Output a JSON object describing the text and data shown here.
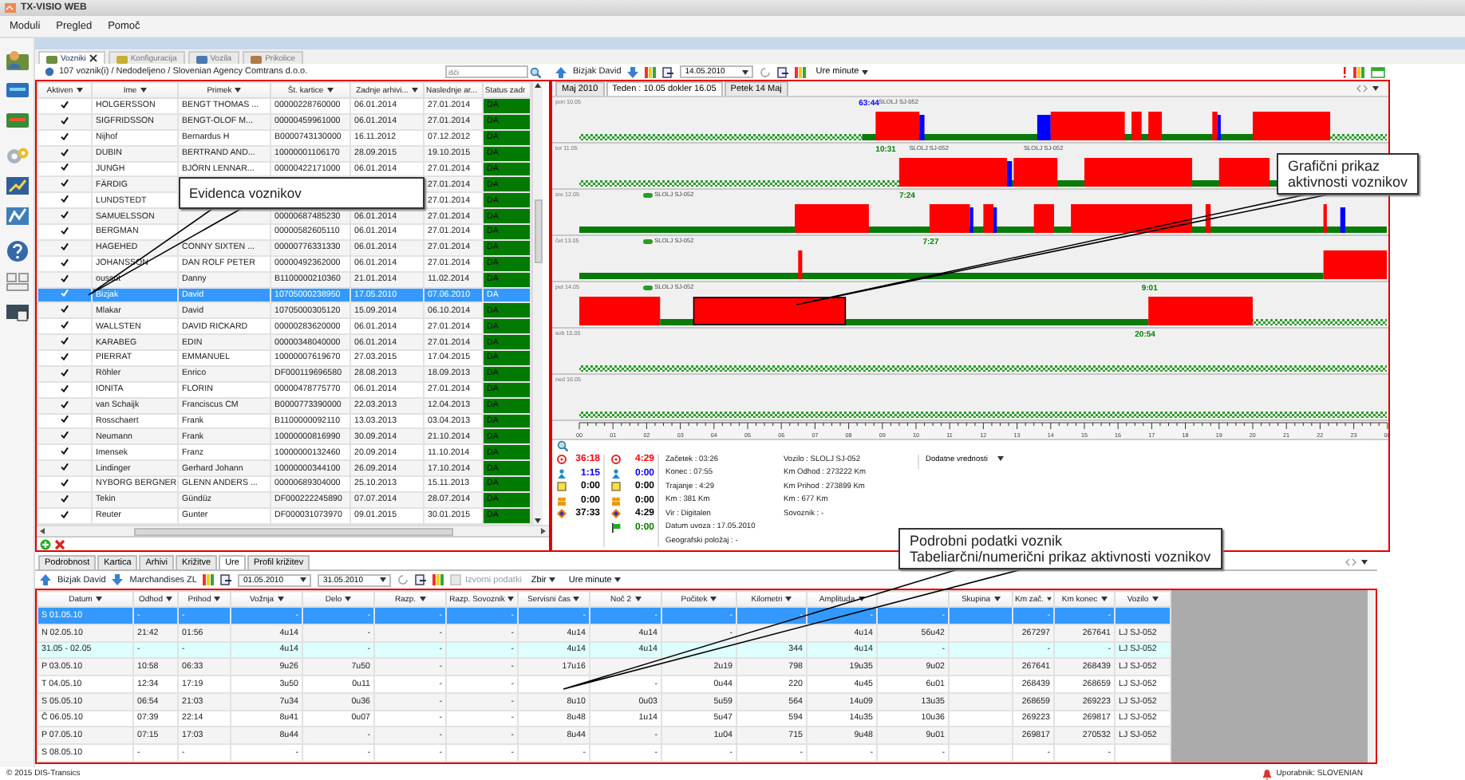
{
  "window": {
    "title": "TX-VISIO WEB"
  },
  "menu": [
    "Moduli",
    "Pregled",
    "Pomoč"
  ],
  "module_tabs": [
    {
      "label": "Vozniki",
      "selected": true,
      "closable": true
    },
    {
      "label": "Konfiguracija",
      "selected": false,
      "closable": false
    },
    {
      "label": "Vozila",
      "selected": false,
      "closable": false
    },
    {
      "label": "Prikolice",
      "selected": false,
      "closable": false
    }
  ],
  "breadcrumb": "107 voznik(i) / Nedodeljeno / Slovenian Agency Comtrans d.o.o.",
  "search": {
    "placeholder": "išči"
  },
  "drivers": {
    "active_column": "Aktiven",
    "columns": [
      "Ime",
      "Primek",
      "Št. kartice",
      "Zadnje arhivi...",
      "Naslednje ar..."
    ],
    "status_column": "Status zadr",
    "rows": [
      {
        "active": true,
        "selected": false,
        "cells": [
          "HOLGERSSON",
          "BENGT THOMAS ...",
          "00000228760000",
          "06.01.2014",
          "27.01.2014"
        ],
        "status": "DA"
      },
      {
        "active": true,
        "selected": false,
        "cells": [
          "SIGFRIDSSON",
          "BENGT-OLOF M...",
          "00000459961000",
          "06.01.2014",
          "27.01.2014"
        ],
        "status": "DA"
      },
      {
        "active": true,
        "selected": false,
        "cells": [
          "Nijhof",
          "Bernardus H",
          "B0000743130000",
          "16.11.2012",
          "07.12.2012"
        ],
        "status": "DA"
      },
      {
        "active": true,
        "selected": false,
        "cells": [
          "DUBIN",
          "BERTRAND AND...",
          "10000001106170",
          "28.09.2015",
          "19.10.2015"
        ],
        "status": "DA"
      },
      {
        "active": true,
        "selected": false,
        "cells": [
          "JUNGH",
          "BJÖRN LENNAR...",
          "00000422171000",
          "06.01.2014",
          "27.01.2014"
        ],
        "status": "DA"
      },
      {
        "active": true,
        "selected": false,
        "cells": [
          "FÄRDIG",
          null,
          null,
          null,
          "27.01.2014"
        ],
        "status": "DA"
      },
      {
        "active": true,
        "selected": false,
        "cells": [
          "LUNDSTEDT",
          null,
          null,
          null,
          "27.01.2014"
        ],
        "status": "DA"
      },
      {
        "active": true,
        "selected": false,
        "cells": [
          "SAMUELSSON",
          null,
          "00000687485230",
          "06.01.2014",
          "27.01.2014"
        ],
        "status": "DA"
      },
      {
        "active": true,
        "selected": false,
        "cells": [
          "BERGMAN",
          null,
          "00000582605110",
          "06.01.2014",
          "27.01.2014"
        ],
        "status": "DA"
      },
      {
        "active": true,
        "selected": false,
        "cells": [
          "HAGEHED",
          "CONNY SIXTEN ...",
          "00000776331330",
          "06.01.2014",
          "27.01.2014"
        ],
        "status": "DA"
      },
      {
        "active": true,
        "selected": false,
        "cells": [
          "JOHANSSON",
          "DAN ROLF PETER",
          "00000492362000",
          "06.01.2014",
          "27.01.2014"
        ],
        "status": "DA"
      },
      {
        "active": true,
        "selected": false,
        "cells": [
          "oussot",
          "Danny",
          "B1100000210360",
          "21.01.2014",
          "11.02.2014"
        ],
        "status": "DA"
      },
      {
        "active": true,
        "selected": true,
        "cells": [
          "Bizjak",
          "David",
          "10705000238950",
          "17.05.2010",
          "07.06.2010"
        ],
        "status": "DA"
      },
      {
        "active": true,
        "selected": false,
        "cells": [
          "Mlakar",
          "David",
          "10705000305120",
          "15.09.2014",
          "06.10.2014"
        ],
        "status": "DA"
      },
      {
        "active": true,
        "selected": false,
        "cells": [
          "WALLSTEN",
          "DAVID RICKARD",
          "00000283620000",
          "06.01.2014",
          "27.01.2014"
        ],
        "status": "DA"
      },
      {
        "active": true,
        "selected": false,
        "cells": [
          "KARABEG",
          "EDIN",
          "00000348040000",
          "06.01.2014",
          "27.01.2014"
        ],
        "status": "DA"
      },
      {
        "active": true,
        "selected": false,
        "cells": [
          "PIERRAT",
          "EMMANUEL",
          "10000007619670",
          "27.03.2015",
          "17.04.2015"
        ],
        "status": "DA"
      },
      {
        "active": true,
        "selected": false,
        "cells": [
          "Röhler",
          "Enrico",
          "DF000119696580",
          "28.08.2013",
          "18.09.2013"
        ],
        "status": "DA"
      },
      {
        "active": true,
        "selected": false,
        "cells": [
          "IONITA",
          "FLORIN",
          "00000478775770",
          "06.01.2014",
          "27.01.2014"
        ],
        "status": "DA"
      },
      {
        "active": true,
        "selected": false,
        "cells": [
          "van Schaijk",
          "Franciscus CM",
          "B0000773390000",
          "22.03.2013",
          "12.04.2013"
        ],
        "status": "DA"
      },
      {
        "active": true,
        "selected": false,
        "cells": [
          "Rosschaert",
          "Frank",
          "B1100000092110",
          "13.03.2013",
          "03.04.2013"
        ],
        "status": "DA"
      },
      {
        "active": true,
        "selected": false,
        "cells": [
          "Neumann",
          "Frank",
          "10000000816990",
          "30.09.2014",
          "21.10.2014"
        ],
        "status": "DA"
      },
      {
        "active": true,
        "selected": false,
        "cells": [
          "Imensek",
          "Franz",
          "10000000132460",
          "20.09.2014",
          "11.10.2014"
        ],
        "status": "DA"
      },
      {
        "active": true,
        "selected": false,
        "cells": [
          "Lindinger",
          "Gerhard Johann",
          "10000000344100",
          "26.09.2014",
          "17.10.2014"
        ],
        "status": "DA"
      },
      {
        "active": true,
        "selected": false,
        "cells": [
          "NYBORG BERGNER",
          "GLENN ANDERS ...",
          "00000689304000",
          "25.10.2013",
          "15.11.2013"
        ],
        "status": "DA"
      },
      {
        "active": true,
        "selected": false,
        "cells": [
          "Tekin",
          "Gündüz",
          "DF000222245890",
          "07.07.2014",
          "28.07.2014"
        ],
        "status": "DA"
      },
      {
        "active": true,
        "selected": false,
        "cells": [
          "Reuter",
          "Gunter",
          "DF000031073970",
          "09.01.2015",
          "30.01.2015"
        ],
        "status": "DA"
      }
    ]
  },
  "timeline": {
    "driver": "Bizjak David",
    "date": "14.05.2010",
    "units": "Ure minute",
    "tabs": [
      {
        "label": "Maj 2010",
        "selected": false
      },
      {
        "label": "Teden : 10.05 dokler 16.05",
        "selected": true
      },
      {
        "label": "Petek 14 Maj",
        "selected": false
      }
    ],
    "days": [
      {
        "label": "pon 10.05",
        "notes": [
          {
            "kind": "time",
            "text": "63:44",
            "color": "#0000ff"
          },
          {
            "kind": "vehicle",
            "text": "SLOLJ SJ-052"
          }
        ]
      },
      {
        "label": "tor 11.05",
        "notes": [
          {
            "kind": "time",
            "text": "10:31",
            "color": "#008000"
          },
          {
            "kind": "vehicle",
            "text": "SLOLJ SJ-052"
          },
          {
            "kind": "vehicle",
            "text": "SLOLJ SJ-052"
          }
        ]
      },
      {
        "label": "sre 12.05",
        "notes": [
          {
            "kind": "tagged",
            "text": "SLOLJ SJ-052"
          },
          {
            "kind": "time",
            "text": "7:24",
            "color": "#008000"
          }
        ]
      },
      {
        "label": "čet 13.05",
        "notes": [
          {
            "kind": "tagged",
            "text": "SLOLJ SJ-052"
          },
          {
            "kind": "time",
            "text": "7:27",
            "color": "#008000"
          }
        ]
      },
      {
        "label": "pet 14.05",
        "notes": [
          {
            "kind": "tagged",
            "text": "SLOLJ SJ-052"
          },
          {
            "kind": "time",
            "text": "9:01",
            "color": "#008000"
          }
        ]
      },
      {
        "label": "sob 15.05",
        "notes": [
          {
            "kind": "time",
            "text": "20:54",
            "color": "#008000"
          }
        ]
      },
      {
        "label": "ned 16.05"
      }
    ],
    "hours": [
      "00",
      "01",
      "02",
      "03",
      "04",
      "05",
      "06",
      "07",
      "08",
      "09",
      "10",
      "11",
      "12",
      "13",
      "14",
      "15",
      "16",
      "17",
      "18",
      "19",
      "20",
      "21",
      "22",
      "23",
      "00"
    ]
  },
  "summary": {
    "counters": [
      [
        {
          "value": "36:18",
          "color": "#ff0000"
        },
        {
          "value": "1:15",
          "color": "#0000ff"
        },
        {
          "value": "0:00",
          "color": "#000000"
        },
        {
          "value": "0:00",
          "color": "#000000"
        },
        {
          "value": "37:33",
          "color": "#000000"
        }
      ],
      [
        {
          "value": "4:29",
          "color": "#ff0000"
        },
        {
          "value": "0:00",
          "color": "#0000ff"
        },
        {
          "value": "0:00",
          "color": "#000000"
        },
        {
          "value": "0:00",
          "color": "#000000"
        },
        {
          "value": "4:29",
          "color": "#000000"
        },
        {
          "value": "0:00",
          "color": "#008000"
        }
      ]
    ],
    "fields": [
      [
        "Začetek : 03:26",
        "Konec : 07:55",
        "Trajanje : 4:29",
        "Km : 381 Km",
        "Vir : Digitalen",
        "Datum uvoza : 17.05.2010",
        "Geografski položaj :  -"
      ],
      [
        "Vozilo : SLOLJ SJ-052",
        "Km Odhod : 273222 Km",
        "Km Prihod : 273899 Km",
        "Km : 677 Km",
        "Sovoznik :  -"
      ]
    ],
    "extra": "Dodatne vrednosti"
  },
  "hours_panel": {
    "tabs": [
      {
        "label": "Podrobnost",
        "selected": false
      },
      {
        "label": "Kartica",
        "selected": false
      },
      {
        "label": "Arhivi",
        "selected": false
      },
      {
        "label": "Križitve",
        "selected": false
      },
      {
        "label": "Ure",
        "selected": true
      },
      {
        "label": "Profil križitev",
        "selected": false
      }
    ],
    "driver": "Bizjak David",
    "vehicle": "Marchandises ZL",
    "date_from": "01.05.2010",
    "date_to": "31.05.2010",
    "raw_data": {
      "label": "Izvorni podatki",
      "checked": false,
      "disabled": true
    },
    "total": "Zbir",
    "units": "Ure minute",
    "columns": [
      "Datum",
      "Odhod",
      "Prihod",
      "Vožnja",
      "Delo",
      "Razp.",
      "Razp. Sovoznik",
      "Servisni čas",
      "Noč 2",
      "Počitek",
      "Kilometri",
      "Amplituda",
      null,
      "Skupina",
      "Km zač.",
      "Km konec",
      "Vozilo"
    ],
    "rows": [
      {
        "kind": "day",
        "selected": true,
        "cells": [
          "S 01.05.10",
          "-",
          "-",
          "-",
          "-",
          "-",
          "-",
          "-",
          "-",
          "-",
          "-",
          "-",
          "-",
          null,
          "-",
          "-",
          null
        ]
      },
      {
        "kind": "day",
        "selected": false,
        "cells": [
          "N 02.05.10",
          "21:42",
          "01:56",
          "4u14",
          "-",
          "-",
          "-",
          "4u14",
          "4u14",
          "-",
          null,
          "4u14",
          "56u42",
          null,
          "267297",
          "267641",
          "LJ SJ-052"
        ]
      },
      {
        "kind": "summary",
        "selected": false,
        "cells": [
          "31.05 - 02.05",
          "-",
          "-",
          "4u14",
          "-",
          "-",
          "-",
          "4u14",
          "4u14",
          null,
          "344",
          "4u14",
          "-",
          null,
          "-",
          "-",
          "LJ SJ-052"
        ]
      },
      {
        "kind": "day",
        "selected": false,
        "cells": [
          "P 03.05.10",
          "10:58",
          "06:33",
          "9u26",
          "7u50",
          "-",
          "-",
          "17u16",
          null,
          "2u19",
          "798",
          "19u35",
          "9u02",
          null,
          "267641",
          "268439",
          "LJ SJ-052"
        ]
      },
      {
        "kind": "day",
        "selected": false,
        "cells": [
          "T 04.05.10",
          "12:34",
          "17:19",
          "3u50",
          "0u11",
          "-",
          "-",
          null,
          "-",
          "0u44",
          "220",
          "4u45",
          "6u01",
          null,
          "268439",
          "268659",
          "LJ SJ-052"
        ]
      },
      {
        "kind": "day",
        "selected": false,
        "cells": [
          "S 05.05.10",
          "06:54",
          "21:03",
          "7u34",
          "0u36",
          "-",
          "-",
          "8u10",
          "0u03",
          "5u59",
          "564",
          "14u09",
          "13u35",
          null,
          "268659",
          "269223",
          "LJ SJ-052"
        ]
      },
      {
        "kind": "day",
        "selected": false,
        "cells": [
          "Č 06.05.10",
          "07:39",
          "22:14",
          "8u41",
          "0u07",
          "-",
          "-",
          "8u48",
          "1u14",
          "5u47",
          "594",
          "14u35",
          "10u36",
          null,
          "269223",
          "269817",
          "LJ SJ-052"
        ]
      },
      {
        "kind": "day",
        "selected": false,
        "cells": [
          "P 07.05.10",
          "07:15",
          "17:03",
          "8u44",
          "-",
          "-",
          "-",
          "8u44",
          "-",
          "1u04",
          "715",
          "9u48",
          "9u01",
          null,
          "269817",
          "270532",
          "LJ SJ-052"
        ]
      },
      {
        "kind": "day",
        "selected": false,
        "cells": [
          "S 08.05.10",
          "-",
          "-",
          "-",
          "-",
          "-",
          "-",
          "-",
          "-",
          "-",
          "-",
          "-",
          "-",
          null,
          "-",
          "-",
          null
        ]
      }
    ]
  },
  "callouts": [
    {
      "lines": [
        "Evidenca voznikov"
      ]
    },
    {
      "lines": [
        "Grafični prikaz",
        "aktivnosti voznikov"
      ]
    },
    {
      "lines": [
        "Podrobni podatki voznik",
        "Tabeliarčni/numerični prikaz aktivnosti voznikov"
      ]
    }
  ],
  "footer": {
    "copyright": "© 2015 DIS-Transics",
    "user": "Uporabnik: SLOVENIAN"
  }
}
